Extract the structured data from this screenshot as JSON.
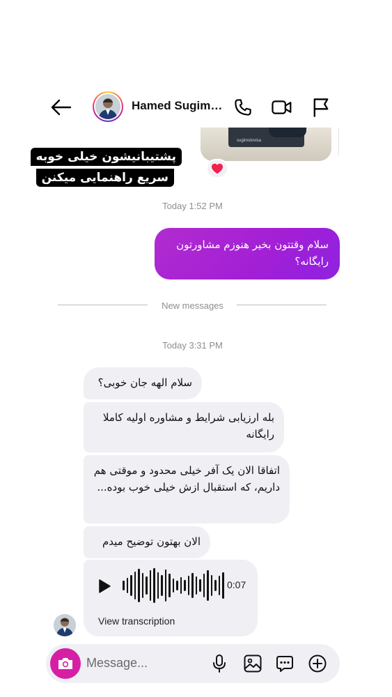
{
  "header": {
    "contact_name": "Hamed Sugim…",
    "icons": [
      "back-arrow-icon",
      "phone-icon",
      "video-call-icon",
      "flag-icon"
    ]
  },
  "shared_media": {
    "watermark": "sugimotovisa",
    "reaction": "❤️"
  },
  "caption": {
    "line1": "پشتیبانیشون خیلی خوبه",
    "line2": "سریع راهنمایی میکنن"
  },
  "thread": {
    "timestamp_1": "Today 1:52 PM",
    "sent_message": "سلام وقتتون بخیر هنوزم مشاورتون رایگانه؟",
    "new_messages_label": "New messages",
    "timestamp_2": "Today 3:31 PM",
    "received": [
      "سلام الهه جان خوبی؟",
      "بله ارزیابی شرایط و مشاوره اولیه کاملا رایگانه",
      "اتفاقا الان یک آفر خیلی محدود و موقتی هم داریم، که استقبال ازش خیلی خوب بوده...",
      "الان بهتون توضیح میدم"
    ],
    "voice": {
      "duration": "0:07",
      "transcription_label": "View transcription"
    }
  },
  "composer": {
    "placeholder": "Message...",
    "icons": [
      "camera-icon",
      "microphone-icon",
      "gallery-icon",
      "sticker-icon",
      "plus-icon"
    ]
  },
  "colors": {
    "sent_bubble": "#a21fd6",
    "received_bubble": "#efeff4",
    "camera_button": "#d61fa5"
  }
}
